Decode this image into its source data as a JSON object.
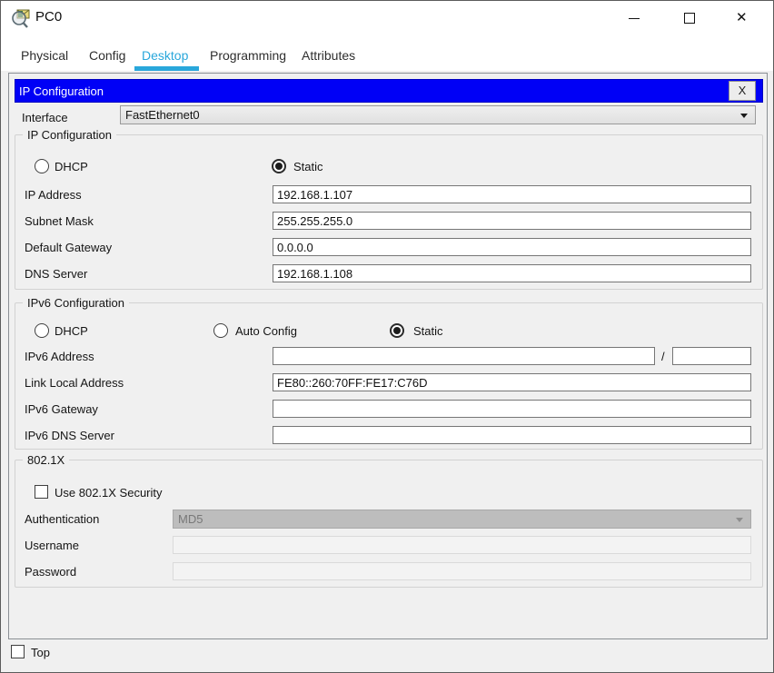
{
  "window": {
    "title": "PC0",
    "close_glyph": "✕"
  },
  "tabs": [
    {
      "label": "Physical",
      "active": false
    },
    {
      "label": "Config",
      "active": false
    },
    {
      "label": "Desktop",
      "active": true
    },
    {
      "label": "Programming",
      "active": false
    },
    {
      "label": "Attributes",
      "active": false
    }
  ],
  "dialog": {
    "title": "IP Configuration",
    "close_label": "X",
    "interface_label": "Interface",
    "interface_value": "FastEthernet0"
  },
  "ip_config": {
    "legend": "IP Configuration",
    "dhcp": {
      "label": "DHCP",
      "checked": false
    },
    "static": {
      "label": "Static",
      "checked": true
    },
    "rows": [
      {
        "label": "IP Address",
        "value": "192.168.1.107"
      },
      {
        "label": "Subnet Mask",
        "value": "255.255.255.0"
      },
      {
        "label": "Default Gateway",
        "value": "0.0.0.0"
      },
      {
        "label": "DNS Server",
        "value": "192.168.1.108"
      }
    ]
  },
  "ipv6_config": {
    "legend": "IPv6 Configuration",
    "dhcp": {
      "label": "DHCP",
      "checked": false
    },
    "auto_config": {
      "label": "Auto Config",
      "checked": false
    },
    "static": {
      "label": "Static",
      "checked": true
    },
    "address": {
      "label": "IPv6 Address",
      "value": "",
      "separator": "/",
      "prefix": ""
    },
    "rows": [
      {
        "label": "Link Local Address",
        "value": "FE80::260:70FF:FE17:C76D"
      },
      {
        "label": "IPv6 Gateway",
        "value": ""
      },
      {
        "label": "IPv6 DNS Server",
        "value": ""
      }
    ]
  },
  "dot1x": {
    "legend": "802.1X",
    "use_security": {
      "label": "Use 802.1X Security",
      "checked": false
    },
    "authentication": {
      "label": "Authentication",
      "value": "MD5"
    },
    "username": {
      "label": "Username",
      "value": ""
    },
    "password": {
      "label": "Password",
      "value": ""
    }
  },
  "footer": {
    "top": {
      "label": "Top",
      "checked": false
    }
  },
  "colors": {
    "dialog_header": "#0000f6",
    "tab_active": "#29a7db",
    "panel_bg": "#f0f0f0"
  }
}
